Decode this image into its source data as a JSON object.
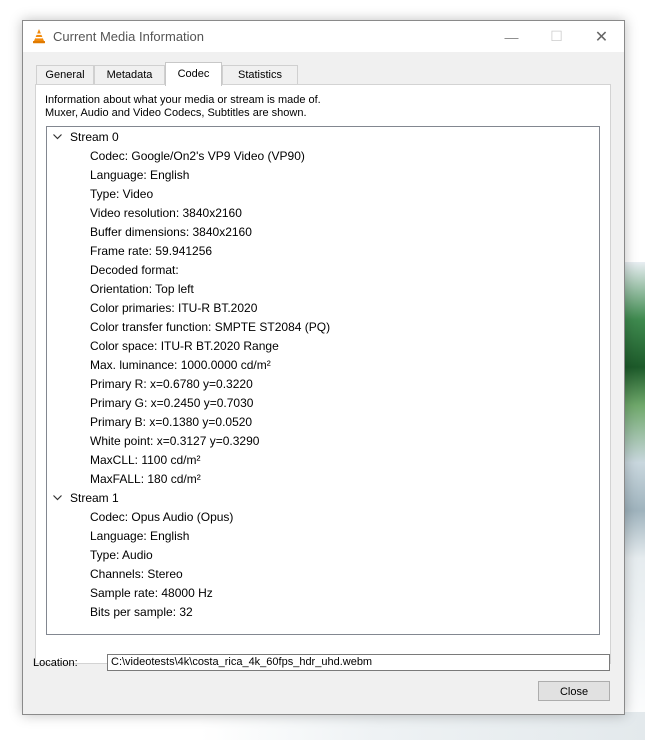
{
  "window": {
    "title": "Current Media Information",
    "controls": {
      "minimize": "—",
      "maximize": "☐",
      "close": "✕"
    }
  },
  "tabs": [
    {
      "label": "General",
      "active": false
    },
    {
      "label": "Metadata",
      "active": false
    },
    {
      "label": "Codec",
      "active": true
    },
    {
      "label": "Statistics",
      "active": false
    }
  ],
  "codec": {
    "description_line1": "Information about what your media or stream is made of.",
    "description_line2": "Muxer, Audio and Video Codecs, Subtitles are shown.",
    "streams": [
      {
        "label": "Stream 0",
        "expanded": true,
        "properties": [
          "Codec: Google/On2's VP9 Video (VP90)",
          "Language: English",
          "Type: Video",
          "Video resolution: 3840x2160",
          "Buffer dimensions: 3840x2160",
          "Frame rate: 59.941256",
          "Decoded format:",
          "Orientation: Top left",
          "Color primaries: ITU-R BT.2020",
          "Color transfer function: SMPTE ST2084 (PQ)",
          "Color space: ITU-R BT.2020 Range",
          "Max. luminance: 1000.0000 cd/m²",
          "Primary R: x=0.6780 y=0.3220",
          "Primary G: x=0.2450 y=0.7030",
          "Primary B: x=0.1380 y=0.0520",
          "White point: x=0.3127 y=0.3290",
          "MaxCLL: 1100 cd/m²",
          "MaxFALL: 180 cd/m²"
        ]
      },
      {
        "label": "Stream 1",
        "expanded": true,
        "properties": [
          "Codec: Opus Audio (Opus)",
          "Language: English",
          "Type: Audio",
          "Channels: Stereo",
          "Sample rate: 48000 Hz",
          "Bits per sample: 32"
        ]
      }
    ]
  },
  "location": {
    "label": "Location:",
    "value": "C:\\videotests\\4k\\costa_rica_4k_60fps_hdr_uhd.webm"
  },
  "buttons": {
    "close": "Close"
  },
  "colors": {
    "vlc_orange": "#f28a0c",
    "border": "#828790"
  }
}
